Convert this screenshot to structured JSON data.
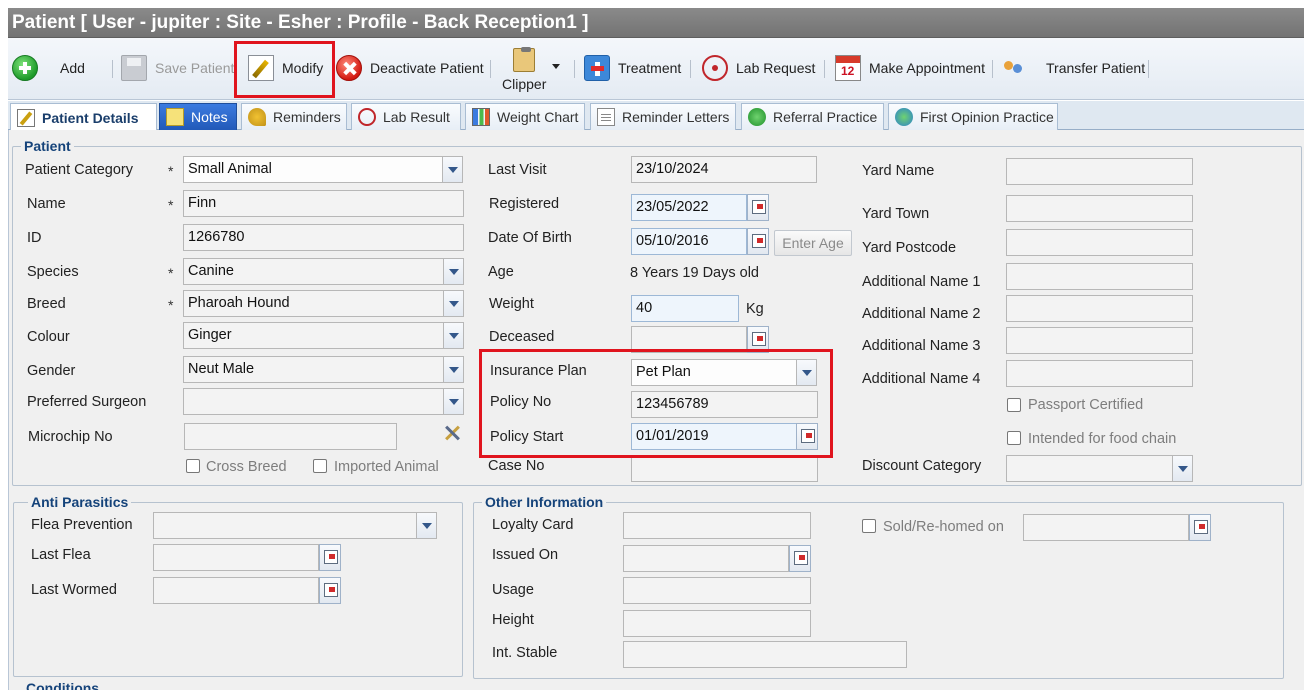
{
  "title": "Patient [ User - jupiter : Site - Esher : Profile - Back Reception1 ]",
  "toolbar": {
    "add": "Add",
    "save": "Save Patient",
    "modify": "Modify",
    "deactivate": "Deactivate Patient",
    "clipper": "Clipper",
    "treatment": "Treatment",
    "lab_request": "Lab Request",
    "make_appointment": "Make Appointment",
    "transfer": "Transfer Patient"
  },
  "tabs": {
    "patient_details": "Patient Details",
    "notes": "Notes",
    "reminders": "Reminders",
    "lab_result": "Lab Result",
    "weight_chart": "Weight Chart",
    "reminder_letters": "Reminder Letters",
    "referral_practice": "Referral Practice",
    "first_opinion": "First Opinion Practice"
  },
  "patient": {
    "legend": "Patient",
    "required_mark": "*",
    "category_label": "Patient Category",
    "category_value": "Small Animal",
    "name_label": "Name",
    "name_value": "Finn",
    "id_label": "ID",
    "id_value": "1266780",
    "species_label": "Species",
    "species_value": "Canine",
    "breed_label": "Breed",
    "breed_value": "Pharoah Hound",
    "colour_label": "Colour",
    "colour_value": "Ginger",
    "gender_label": "Gender",
    "gender_value": "Neut Male",
    "surgeon_label": "Preferred Surgeon",
    "surgeon_value": "",
    "microchip_label": "Microchip No",
    "microchip_value": "",
    "cross_breed": "Cross Breed",
    "imported": "Imported Animal",
    "last_visit_label": "Last Visit",
    "last_visit_value": "23/10/2024",
    "registered_label": "Registered",
    "registered_value": "23/05/2022",
    "dob_label": "Date Of Birth",
    "dob_value": "05/10/2016",
    "enter_age": "Enter Age",
    "age_label": "Age",
    "age_value": "8 Years 19 Days old",
    "weight_label": "Weight",
    "weight_value": "40",
    "weight_unit": "Kg",
    "deceased_label": "Deceased",
    "deceased_value": "",
    "insurance_label": "Insurance Plan",
    "insurance_value": "Pet Plan",
    "policy_no_label": "Policy No",
    "policy_no_value": "123456789",
    "policy_start_label": "Policy Start",
    "policy_start_value": "01/01/2019",
    "case_no_label": "Case No",
    "case_no_value": "",
    "yard_name": "Yard Name",
    "yard_town": "Yard Town",
    "yard_postcode": "Yard Postcode",
    "add_name_1": "Additional Name 1",
    "add_name_2": "Additional Name 2",
    "add_name_3": "Additional Name 3",
    "add_name_4": "Additional Name 4",
    "passport": "Passport Certified",
    "food_chain": "Intended for food chain",
    "discount_label": "Discount Category",
    "discount_value": ""
  },
  "anti": {
    "legend": "Anti Parasitics",
    "flea_prevention": "Flea Prevention",
    "last_flea": "Last Flea",
    "last_wormed": "Last Wormed"
  },
  "other": {
    "legend": "Other Information",
    "loyalty_card": "Loyalty Card",
    "issued_on": "Issued On",
    "usage": "Usage",
    "height": "Height",
    "int_stable": "Int. Stable",
    "sold": "Sold/Re-homed on"
  },
  "conditions_legend": "Conditions"
}
